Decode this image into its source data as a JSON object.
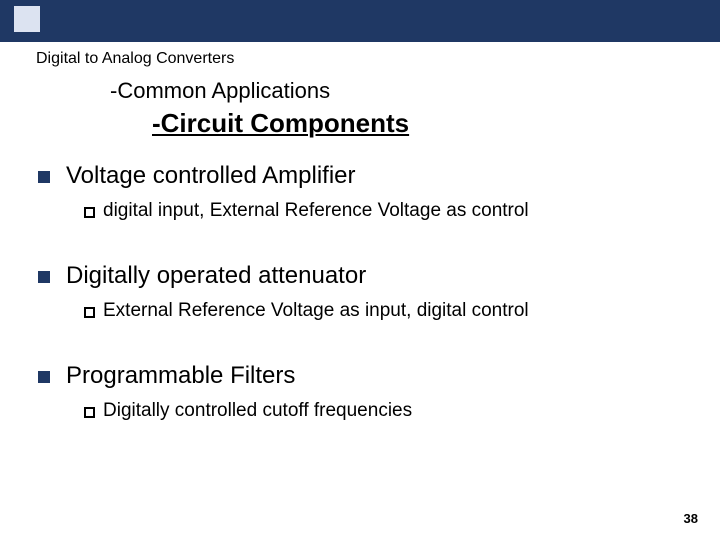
{
  "header": {
    "breadcrumb": "Digital to Analog Converters",
    "subhead": "-Common Applications",
    "section_title": "-Circuit Components"
  },
  "bullets": [
    {
      "title": "Voltage controlled Amplifier",
      "sub_prefix": "digital",
      "sub_rest": " input, External Reference Voltage as control"
    },
    {
      "title": "Digitally operated attenuator",
      "sub_prefix": "External",
      "sub_rest": " Reference Voltage as input, digital control"
    },
    {
      "title": "Programmable Filters",
      "sub_prefix": "Digitally",
      "sub_rest": " controlled cutoff frequencies"
    }
  ],
  "page_number": "38"
}
